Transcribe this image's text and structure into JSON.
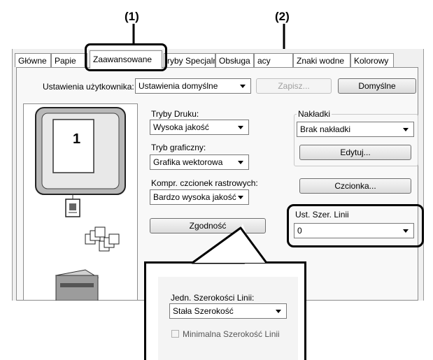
{
  "callouts": {
    "one": "(1)",
    "two": "(2)"
  },
  "tabs": [
    {
      "label": "Główne"
    },
    {
      "label": "Papie"
    },
    {
      "label": "Zaawansowane"
    },
    {
      "label": "ryby Specjalne"
    },
    {
      "label": "Obsługa"
    },
    {
      "label": "acy"
    },
    {
      "label": "Znaki wodne"
    },
    {
      "label": "Kolorowy"
    }
  ],
  "user_settings": {
    "label": "Ustawienia użytkownika:",
    "value": "Ustawienia domyślne",
    "save_button": "Zapisz...",
    "default_button": "Domyślne"
  },
  "preview": {
    "page_number": "1"
  },
  "print_modes": {
    "label": "Tryby Druku:",
    "value": "Wysoka jakość"
  },
  "graphics_mode": {
    "label": "Tryb graficzny:",
    "value": "Grafika wektorowa"
  },
  "raster_font": {
    "label": "Kompr. czcionek rastrowych:",
    "value": "Bardzo wysoka jakość"
  },
  "compat_button": "Zgodność",
  "overlays": {
    "label": "Nakładki",
    "value": "Brak nakładki",
    "edit_button": "Edytuj..."
  },
  "font_button": "Czcionka...",
  "line_width": {
    "label": "Ust. Szer. Linii",
    "value": "0"
  },
  "zoom_panel": {
    "unit_label": "Jedn. Szerokości Linii:",
    "unit_value": "Stała Szerokość",
    "min_width_label": "Minimalna Szerokość Linii"
  }
}
